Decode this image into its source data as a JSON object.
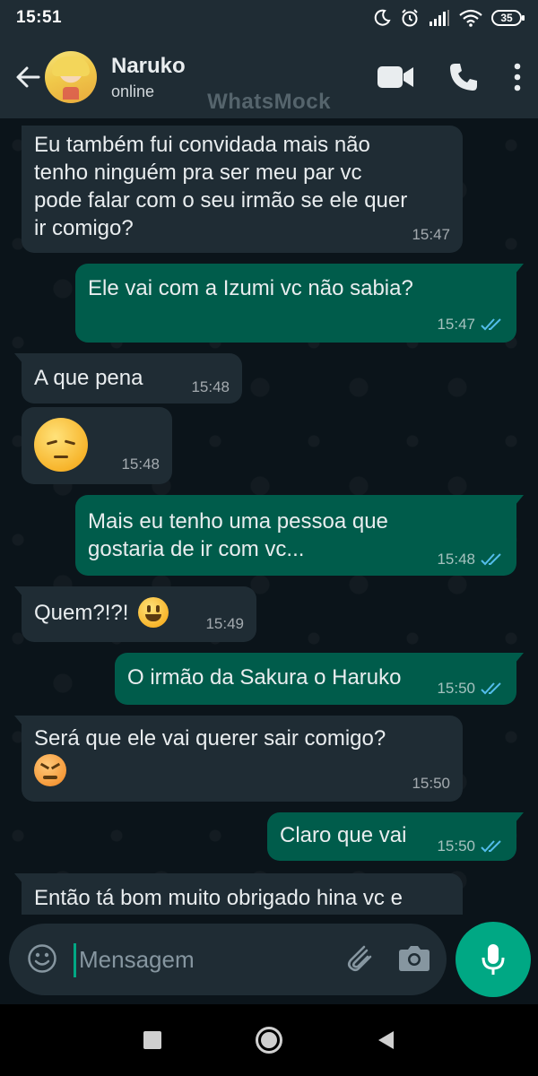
{
  "status_bar": {
    "time": "15:51",
    "battery": "35",
    "icons": [
      "moon-icon",
      "alarm-icon",
      "signal-icon",
      "wifi-icon",
      "battery-icon"
    ]
  },
  "header": {
    "contact_name": "Naruko",
    "contact_status": "online",
    "watermark": "WhatsMock",
    "icons": [
      "back-arrow-icon",
      "video-call-icon",
      "phone-icon",
      "more-icon"
    ]
  },
  "messages": [
    {
      "direction": "in",
      "text": "Eu também fui convidada mais não\ntenho ninguém pra ser meu par vc\npode falar com o seu irmão se ele quer\nir comigo?",
      "time": "15:47"
    },
    {
      "direction": "out",
      "text": "Ele vai com a Izumi vc não sabia?",
      "time": "15:47",
      "read": true
    },
    {
      "direction": "in",
      "text": "A que pena",
      "time": "15:48"
    },
    {
      "direction": "in",
      "emoji": "pensive-face",
      "time": "15:48"
    },
    {
      "direction": "out",
      "text": "Mais eu tenho uma pessoa que\ngostaria de ir com vc...",
      "time": "15:48",
      "read": true
    },
    {
      "direction": "in",
      "text": "Quem?!?!",
      "emoji": "grinning-face",
      "time": "15:49"
    },
    {
      "direction": "out",
      "text": "O irmão da Sakura o Haruko",
      "time": "15:50",
      "read": true
    },
    {
      "direction": "in",
      "text": "Será que ele vai querer sair comigo?",
      "emoji": "persevering-face",
      "time": "15:50"
    },
    {
      "direction": "out",
      "text": "Claro que vai",
      "time": "15:50",
      "read": true
    },
    {
      "direction": "in",
      "text": "Então tá bom muito obrigado hina vc e",
      "time": ""
    }
  ],
  "input": {
    "placeholder": "Mensagem",
    "value": ""
  },
  "colors": {
    "header_bg": "#1f2c34",
    "chat_bg": "#0b141a",
    "incoming_bubble": "#1f2c34",
    "outgoing_bubble": "#005c4b",
    "accent": "#00a884",
    "read_tick": "#53bdeb"
  }
}
